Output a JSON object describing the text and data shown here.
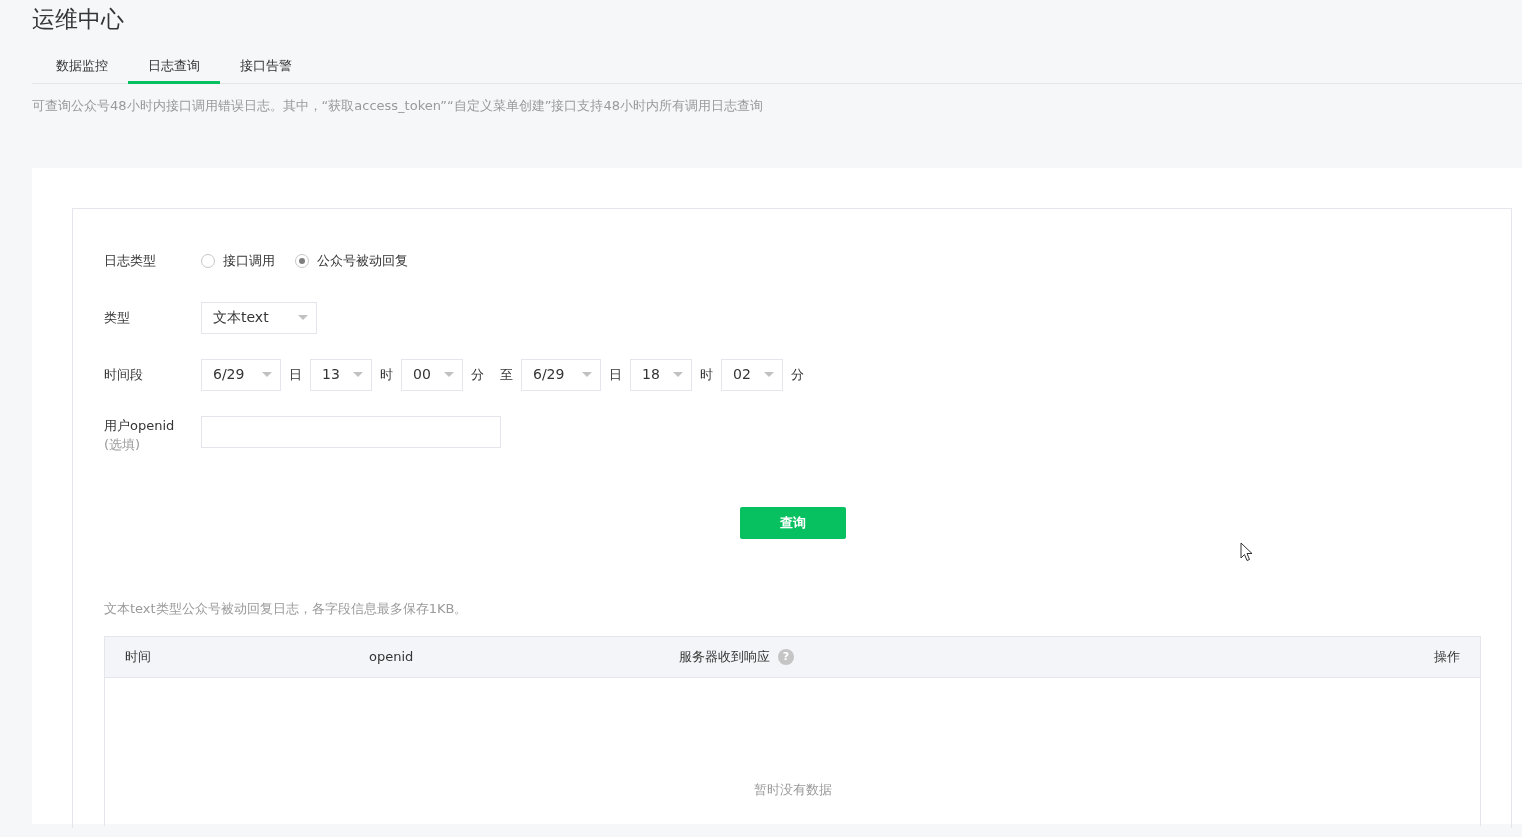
{
  "page_title": "运维中心",
  "tabs": [
    {
      "label": "数据监控",
      "selected": false
    },
    {
      "label": "日志查询",
      "selected": true
    },
    {
      "label": "接口告警",
      "selected": false
    }
  ],
  "description": "可查询公众号48小时内接口调用错误日志。其中，“获取access_token”“自定义菜单创建”接口支持48小时内所有调用日志查询",
  "form": {
    "log_type": {
      "label": "日志类型",
      "options": [
        {
          "label": "接口调用",
          "selected": false
        },
        {
          "label": "公众号被动回复",
          "selected": true
        }
      ]
    },
    "type": {
      "label": "类型",
      "value": "文本text"
    },
    "time_range": {
      "label": "时间段",
      "parts": [
        {
          "kind": "select",
          "value": "6/29"
        },
        {
          "kind": "unit",
          "text": "日"
        },
        {
          "kind": "select",
          "value": "13"
        },
        {
          "kind": "unit",
          "text": "时"
        },
        {
          "kind": "select",
          "value": "00"
        },
        {
          "kind": "unit",
          "text": "分"
        },
        {
          "kind": "unit",
          "text": "至"
        },
        {
          "kind": "select",
          "value": "6/29"
        },
        {
          "kind": "unit",
          "text": "日"
        },
        {
          "kind": "select",
          "value": "18"
        },
        {
          "kind": "unit",
          "text": "时"
        },
        {
          "kind": "select",
          "value": "02"
        },
        {
          "kind": "unit",
          "text": "分"
        }
      ]
    },
    "openid": {
      "label": "用户openid",
      "hint": "(选填)"
    },
    "submit": "查询"
  },
  "note": "文本text类型公众号被动回复日志，各字段信息最多保存1KB。",
  "table": {
    "columns": [
      {
        "label": "时间"
      },
      {
        "label": "openid"
      },
      {
        "label": "服务器收到响应",
        "help": "?"
      },
      {
        "label": "操作"
      }
    ],
    "empty_text": "暂时没有数据"
  }
}
